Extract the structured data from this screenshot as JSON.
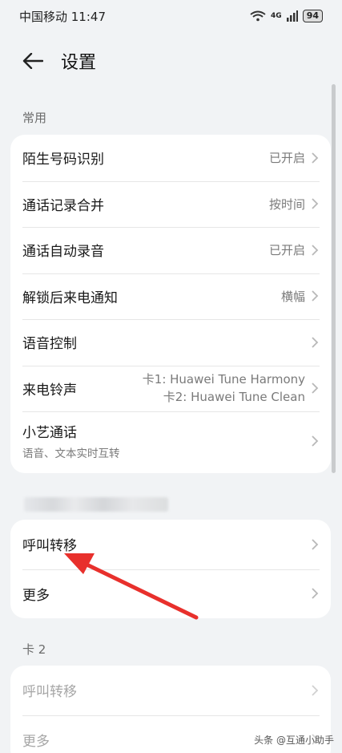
{
  "status_bar": {
    "carrier_time": "中国移动 11:47",
    "network": "4G",
    "battery": "94"
  },
  "header": {
    "title": "设置"
  },
  "sections": {
    "common_label": "常用",
    "common_rows": [
      {
        "label": "陌生号码识别",
        "value": "已开启"
      },
      {
        "label": "通话记录合并",
        "value": "按时间"
      },
      {
        "label": "通话自动录音",
        "value": "已开启"
      },
      {
        "label": "解锁后来电通知",
        "value": "横幅"
      },
      {
        "label": "语音控制",
        "value": ""
      },
      {
        "label": "来电铃声",
        "value_line1": "卡1: Huawei Tune Harmony",
        "value_line2": "卡2: Huawei Tune Clean"
      },
      {
        "label": "小艺通话",
        "sub": "语音、文本实时互转"
      }
    ],
    "card1_rows": [
      {
        "label": "呼叫转移"
      },
      {
        "label": "更多"
      }
    ],
    "card2_label": "卡 2",
    "card2_rows": [
      {
        "label": "呼叫转移"
      },
      {
        "label": "更多"
      }
    ]
  },
  "watermark": "头条 @互通小助手",
  "colors": {
    "background": "#f1f3f5",
    "card": "#ffffff",
    "annotation_arrow": "#e8302c"
  }
}
